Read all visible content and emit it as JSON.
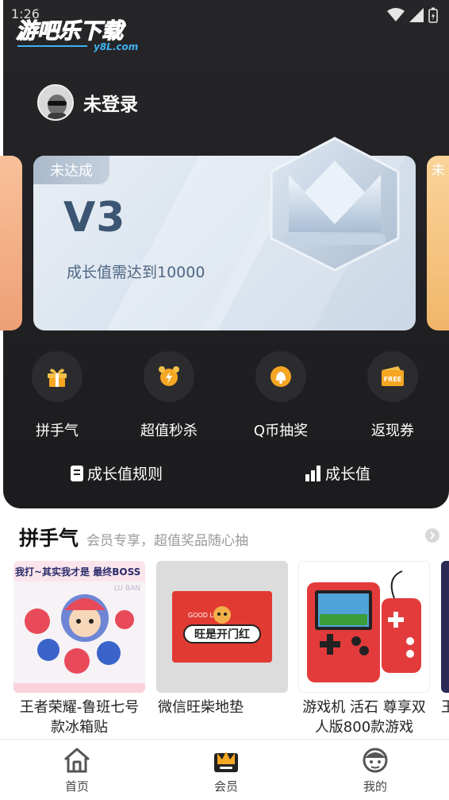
{
  "status": {
    "time": "1:26"
  },
  "logo": {
    "main": "游吧乐下载",
    "sub": "y8L.com"
  },
  "user": {
    "name": "未登录"
  },
  "vip_card": {
    "tag": "未达成",
    "level": "V3",
    "desc": "成长值需达到10000",
    "right_peek_tag": "未"
  },
  "icons": [
    {
      "icon": "gift-icon",
      "label": "拼手气"
    },
    {
      "icon": "alarm-clock-icon",
      "label": "超值秒杀"
    },
    {
      "icon": "bell-coin-icon",
      "label": "Q币抽奖"
    },
    {
      "icon": "coupon-icon",
      "label": "返现券"
    }
  ],
  "links": {
    "rules": "成长值规则",
    "growth": "成长值"
  },
  "section": {
    "title": "拼手气",
    "subtitle": "会员专享，超值奖品随心抽"
  },
  "products": [
    {
      "name_line1": "王者荣耀-鲁班七号",
      "name_line2": "款冰箱贴",
      "banner": "我打~其实我才是 最终BOSS",
      "banner_sub": "LU BAN"
    },
    {
      "name_line1": "微信旺柴地垫",
      "name_line2": "",
      "mat_text": "旺是开门红",
      "mat_top": "GOOD  LOOK"
    },
    {
      "name_line1": "游戏机 活石 尊享双",
      "name_line2": "人版800款游戏"
    },
    {
      "name_line1": "王",
      "name_line2": ""
    }
  ],
  "tabs": [
    {
      "label": "首页"
    },
    {
      "label": "会员"
    },
    {
      "label": "我的"
    }
  ],
  "colors": {
    "accent": "#f5a623",
    "dark_bg": "#1c1c1e",
    "card": "#dbe5ef"
  }
}
